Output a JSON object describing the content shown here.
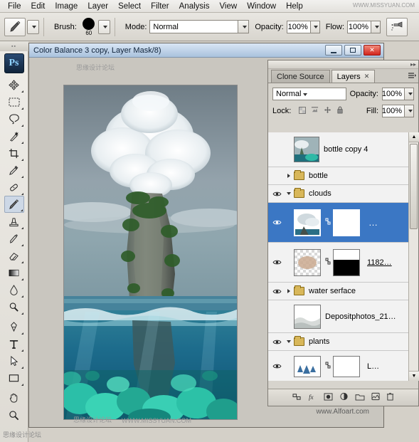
{
  "menubar": {
    "items": [
      "File",
      "Edit",
      "Image",
      "Layer",
      "Select",
      "Filter",
      "Analysis",
      "View",
      "Window",
      "Help"
    ]
  },
  "options_bar": {
    "tool_icon": "brush-tool-icon",
    "brush_label": "Brush:",
    "brush_size": "60",
    "mode_label": "Mode:",
    "mode_value": "Normal",
    "opacity_label": "Opacity:",
    "opacity_value": "100%",
    "flow_label": "Flow:",
    "flow_value": "100%",
    "airbrush_icon": "airbrush-icon"
  },
  "toolbox": {
    "app_logo": "Ps",
    "tools": [
      {
        "name": "move-tool",
        "icon": "move-icon"
      },
      {
        "name": "marquee-tool",
        "icon": "rect-marquee-icon"
      },
      {
        "name": "lasso-tool",
        "icon": "lasso-icon"
      },
      {
        "name": "quick-select-tool",
        "icon": "magic-wand-icon"
      },
      {
        "name": "crop-tool",
        "icon": "crop-icon"
      },
      {
        "name": "eyedropper-tool",
        "icon": "eyedropper-icon"
      },
      {
        "name": "healing-brush-tool",
        "icon": "bandage-icon"
      },
      {
        "name": "brush-tool",
        "icon": "paintbrush-icon"
      },
      {
        "name": "clone-stamp-tool",
        "icon": "stamp-icon"
      },
      {
        "name": "history-brush-tool",
        "icon": "history-brush-icon"
      },
      {
        "name": "eraser-tool",
        "icon": "eraser-icon"
      },
      {
        "name": "gradient-tool",
        "icon": "gradient-icon"
      },
      {
        "name": "blur-tool",
        "icon": "droplet-icon"
      },
      {
        "name": "dodge-tool",
        "icon": "dodge-icon"
      },
      {
        "name": "pen-tool",
        "icon": "pen-icon"
      },
      {
        "name": "type-tool",
        "icon": "text-T-icon"
      },
      {
        "name": "path-selection-tool",
        "icon": "path-arrow-icon"
      },
      {
        "name": "shape-tool",
        "icon": "rectangle-shape-icon"
      },
      {
        "name": "hand-tool",
        "icon": "hand-icon"
      },
      {
        "name": "zoom-tool",
        "icon": "magnifier-icon"
      }
    ]
  },
  "document": {
    "title": "Color Balance 3 copy, Layer Mask/8)",
    "min_label": "",
    "max_label": "",
    "close_label": "✕"
  },
  "layers_panel": {
    "tabs": [
      {
        "label": "Clone Source",
        "active": false,
        "closable": false
      },
      {
        "label": "Layers",
        "active": true,
        "closable": true
      }
    ],
    "blend_mode": "Normal",
    "opacity_label": "Opacity:",
    "opacity_value": "100%",
    "lock_label": "Lock:",
    "fill_label": "Fill:",
    "fill_value": "100%",
    "layers": [
      {
        "name": "bottle copy 4",
        "visible": false,
        "type": "image",
        "selected": false,
        "expandable": false
      },
      {
        "name": "bottle",
        "visible": false,
        "type": "group",
        "selected": false,
        "expandable": true,
        "expanded": false
      },
      {
        "name": "clouds",
        "visible": true,
        "type": "group",
        "selected": false,
        "expandable": true,
        "expanded": true
      },
      {
        "name": "",
        "visible": true,
        "type": "image-mask",
        "selected": true,
        "expandable": false,
        "extra": "…"
      },
      {
        "name": "1182…",
        "visible": true,
        "type": "image-mask",
        "selected": false,
        "expandable": false
      },
      {
        "name": "water serface",
        "visible": true,
        "type": "group",
        "selected": false,
        "expandable": true,
        "expanded": false
      },
      {
        "name": "Depositphotos_21…",
        "visible": false,
        "type": "image",
        "selected": false,
        "expandable": false
      },
      {
        "name": "plants",
        "visible": true,
        "type": "group",
        "selected": false,
        "expandable": true,
        "expanded": true
      },
      {
        "name": "L…",
        "visible": true,
        "type": "image-mask",
        "selected": false,
        "expandable": false
      }
    ],
    "footer_icons": [
      "link-layers-icon",
      "layer-style-fx-icon",
      "add-mask-icon",
      "new-adjustment-layer-icon",
      "new-group-icon",
      "new-layer-icon",
      "delete-layer-icon"
    ]
  },
  "watermarks": {
    "bottom_left": "思缘设计论坛",
    "title_overlay": "思缘设计论坛",
    "top_right": "WWW.MISSYUAN.COM",
    "bottom_center": "WWW.MISSYUAN.COM",
    "bottom_right": "www.Alfoart.com"
  },
  "colors": {
    "chrome": "#d4d0c8",
    "selection_blue": "#3b77c4",
    "titlebar_blue": "#a9c2dd",
    "close_red": "#d2241c",
    "folder_yellow": "#d8b75a"
  }
}
